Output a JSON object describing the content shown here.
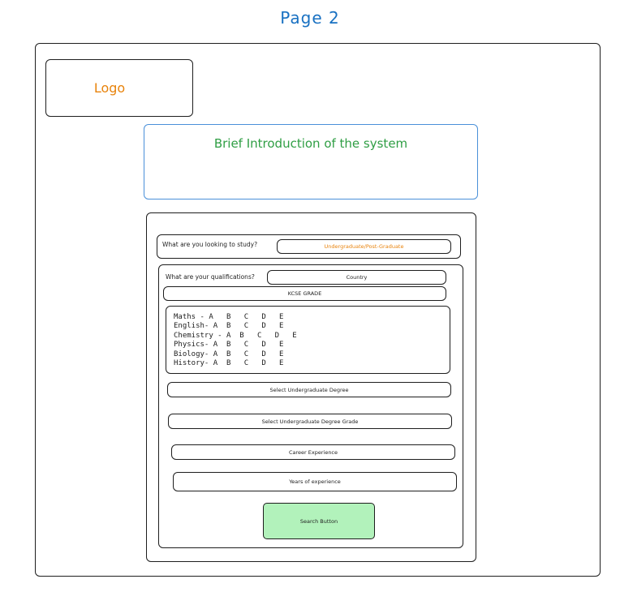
{
  "page": {
    "title": "Page 2"
  },
  "header": {
    "logo_label": "Logo"
  },
  "intro": {
    "title": "Brief Introduction of the system"
  },
  "form": {
    "study_question": "What are you looking to study?",
    "study_select": "Undergraduate/Post-Graduate",
    "qualifications_question": "What are your qualifications?",
    "country_select": "Country",
    "grade_select": "KCSE GRADE",
    "subjects": [
      {
        "line": "Maths - A   B   C   D   E"
      },
      {
        "line": "English- A  B   C   D   E"
      },
      {
        "line": "Chemistry - A  B   C   D   E"
      },
      {
        "line": "Physics- A  B   C   D   E"
      },
      {
        "line": "Biology- A  B   C   D   E"
      },
      {
        "line": "History- A  B   C   D   E"
      }
    ],
    "undergrad_degree_select": "Select Undergraduate Degree",
    "undergrad_grade_select": "Select Undergraduate Degree Grade",
    "career_experience_field": "Career Experience",
    "years_experience_field": "Years of experience",
    "search_button": "Search Button"
  },
  "colors": {
    "title": "#1971c2",
    "logo": "#e8830c",
    "intro": "#2f9e44",
    "button_fill": "#b2f2bb",
    "accent_border": "#4a90d9"
  }
}
